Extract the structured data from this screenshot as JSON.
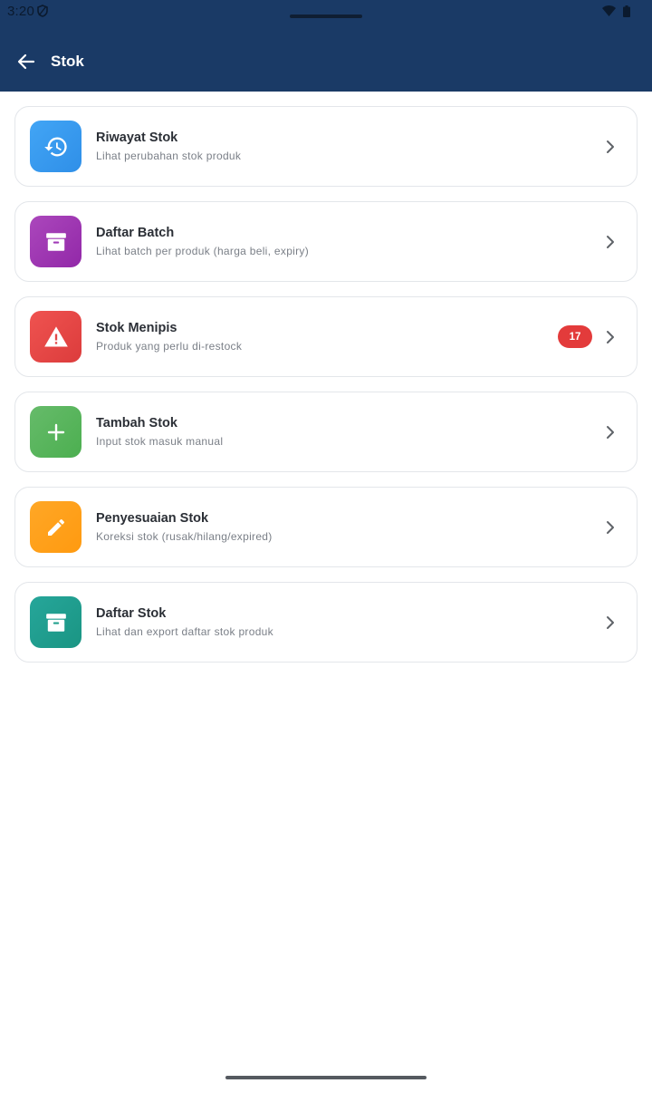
{
  "status_bar": {
    "time": "3:20"
  },
  "appbar": {
    "title": "Stok"
  },
  "menu": [
    {
      "id": "riwayat-stok",
      "title": "Riwayat Stok",
      "subtitle": "Lihat perubahan stok produk",
      "icon": "history-icon",
      "color": "#3b9cf0"
    },
    {
      "id": "daftar-batch",
      "title": "Daftar Batch",
      "subtitle": "Lihat batch per produk (harga beli, expiry)",
      "icon": "archive-icon",
      "color": "#a03bb8"
    },
    {
      "id": "stok-menipis",
      "title": "Stok Menipis",
      "subtitle": "Produk yang perlu di-restock",
      "icon": "warning-icon",
      "color": "#e34848",
      "badge": "17"
    },
    {
      "id": "tambah-stok",
      "title": "Tambah Stok",
      "subtitle": "Input stok masuk manual",
      "icon": "plus-icon",
      "color": "#5ab85e"
    },
    {
      "id": "penyesuaian-stok",
      "title": "Penyesuaian Stok",
      "subtitle": "Koreksi stok (rusak/hilang/expired)",
      "icon": "pencil-icon",
      "color": "#ffa21f"
    },
    {
      "id": "daftar-stok",
      "title": "Daftar Stok",
      "subtitle": "Lihat dan export daftar stok produk",
      "icon": "archive-icon",
      "color": "#23a08e"
    }
  ]
}
